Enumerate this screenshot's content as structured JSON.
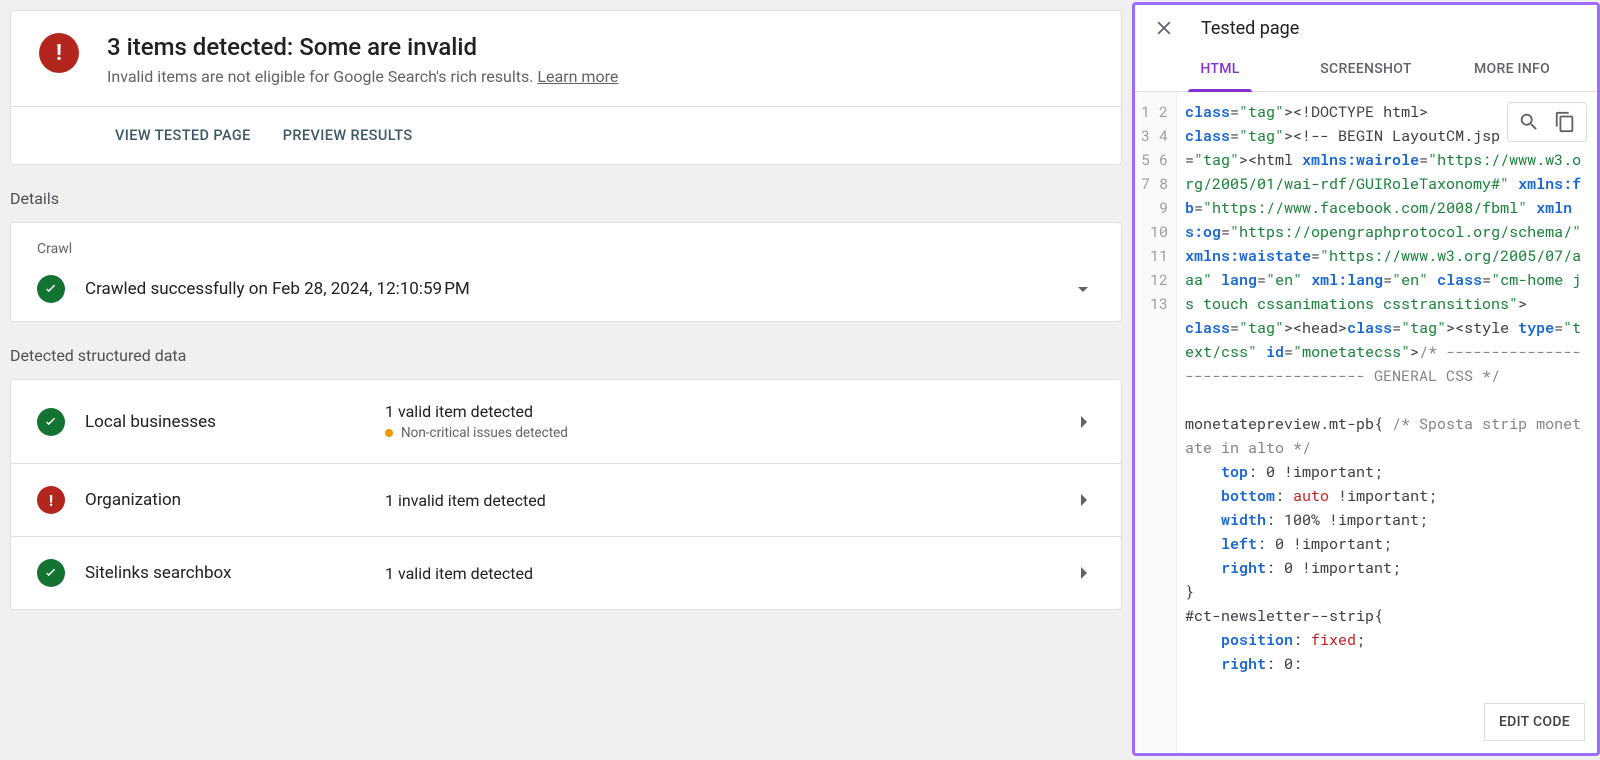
{
  "summary": {
    "title": "3 items detected: Some are invalid",
    "subtitle_prefix": "Invalid items are not eligible for Google Search's rich results. ",
    "learn_more": "Learn more",
    "view_tested": "VIEW TESTED PAGE",
    "preview_results": "PREVIEW RESULTS"
  },
  "sections": {
    "details_label": "Details",
    "structured_label": "Detected structured data"
  },
  "crawl": {
    "label": "Crawl",
    "text": "Crawled successfully on Feb 28, 2024, 12:10:59 PM"
  },
  "items": [
    {
      "status": "success",
      "name": "Local businesses",
      "detected": "1 valid item detected",
      "sub": "Non-critical issues detected"
    },
    {
      "status": "error",
      "name": "Organization",
      "detected": "1 invalid item detected",
      "sub": ""
    },
    {
      "status": "success",
      "name": "Sitelinks searchbox",
      "detected": "1 valid item detected",
      "sub": ""
    }
  ],
  "panel": {
    "title": "Tested page",
    "tabs": [
      "HTML",
      "SCREENSHOT",
      "MORE INFO"
    ],
    "edit": "EDIT CODE",
    "gutter": [
      "1",
      "2",
      " ",
      " ",
      " ",
      " ",
      " ",
      " ",
      " ",
      " ",
      " ",
      "3",
      "4",
      " ",
      "5",
      "6",
      "7",
      "8",
      "9",
      "10",
      "11",
      "12",
      "13"
    ],
    "code_lines": [
      {
        "raw": "<!DOCTYPE html>"
      },
      {
        "raw": "<!-- BEGIN LayoutCM.jsp --><html xmlns:wairole=\"https://www.w3.org/2005/01/wai-rdf/GUIRoleTaxonomy#\" xmlns:fb=\"https://www.facebook.com/2008/fbml\" xmlns:og=\"https://opengraphprotocol.org/schema/\" xmlns:waistate=\"https://www.w3.org/2005/07/aaa\" lang=\"en\" xml:lang=\"en\" class=\"cm-home js touch cssanimations csstransitions\">"
      },
      {
        "raw": "<head><style type=\"text/css\" id=\"monetatecss\">/* ----------------------------------- GENERAL CSS */"
      },
      {
        "raw": ""
      },
      {
        "raw": "monetatepreview.mt-pb{ /* Sposta strip monetate in alto */"
      },
      {
        "raw": "    top: 0 !important;"
      },
      {
        "raw": "    bottom: auto !important;"
      },
      {
        "raw": "    width: 100% !important;"
      },
      {
        "raw": "    left: 0 !important;"
      },
      {
        "raw": "    right: 0 !important;"
      },
      {
        "raw": "}"
      },
      {
        "raw": "#ct-newsletter--strip{"
      },
      {
        "raw": "    position: fixed;"
      },
      {
        "raw": "    right: 0:"
      }
    ]
  }
}
